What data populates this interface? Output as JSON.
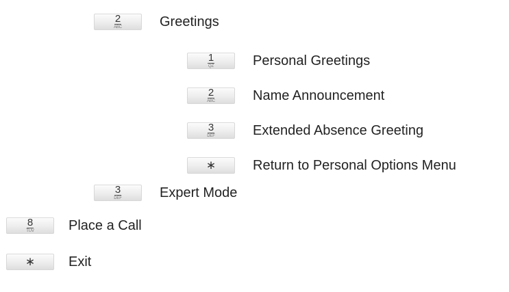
{
  "menu": {
    "greetings": {
      "key_digit": "2",
      "key_letters": "ABC",
      "label": "Greetings"
    },
    "personal_greetings": {
      "key_digit": "1",
      "key_letters": "QZ",
      "label": "Personal Greetings"
    },
    "name_announcement": {
      "key_digit": "2",
      "key_letters": "ABC",
      "label": "Name Announcement"
    },
    "extended_absence": {
      "key_digit": "3",
      "key_letters": "DEF",
      "label": "Extended Absence Greeting"
    },
    "return_personal_options": {
      "key_symbol": "∗",
      "label": "Return to Personal Options Menu"
    },
    "expert_mode": {
      "key_digit": "3",
      "key_letters": "DEF",
      "label": "Expert Mode"
    },
    "place_call": {
      "key_digit": "8",
      "key_letters": "TUV",
      "label": "Place a Call"
    },
    "exit": {
      "key_symbol": "∗",
      "label": "Exit"
    }
  }
}
